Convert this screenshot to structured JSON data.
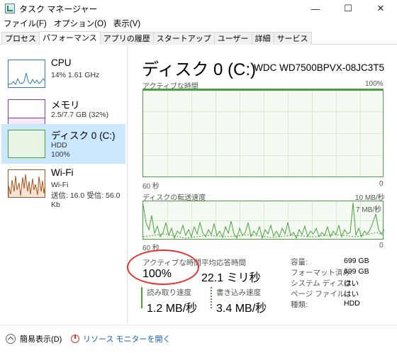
{
  "window": {
    "title": "タスク マネージャー",
    "min": "—",
    "max": "☐",
    "close": "✕"
  },
  "menu": [
    "ファイル(F)",
    "オプション(O)",
    "表示(V)"
  ],
  "tabs": [
    "プロセス",
    "パフォーマンス",
    "アプリの履歴",
    "スタートアップ",
    "ユーザー",
    "詳細",
    "サービス"
  ],
  "sidebar": [
    {
      "name": "CPU",
      "sub1": "14%  1.61 GHz",
      "sub2": "",
      "color": "#2f7bc1"
    },
    {
      "name": "メモリ",
      "sub1": "2.5/7.7 GB (32%)",
      "sub2": "",
      "color": "#8a3bb0"
    },
    {
      "name": "ディスク 0 (C:)",
      "sub1": "HDD",
      "sub2": "100%",
      "color": "#4aa03f"
    },
    {
      "name": "Wi-Fi",
      "sub1": "Wi-Fi",
      "sub2": "送信: 16.0  受信: 56.0 Kb",
      "color": "#a5551e"
    }
  ],
  "main": {
    "title": "ディスク 0 (C:)",
    "model": "WDC WD7500BPVX-08JC3T5",
    "chart1": {
      "label": "アクティブな時間",
      "max": "100%",
      "time_left": "60 秒",
      "time_right": "0"
    },
    "chart2": {
      "label": "ディスクの転送速度",
      "max": "10 MB/秒",
      "mark": "7 MB/秒",
      "time_left": "60 秒",
      "time_right": "0"
    }
  },
  "stats": {
    "active_time_label": "アクティブな時間",
    "active_time_value": "100%",
    "response_label": "平均応答時間",
    "response_value": "22.1 ミリ秒",
    "read_label": "読み取り速度",
    "read_value": "1.2 MB/秒",
    "write_label": "書き込み速度",
    "write_value": "3.4 MB/秒"
  },
  "info": [
    {
      "label": "容量:",
      "value": "699 GB"
    },
    {
      "label": "フォーマット済み:",
      "value": "699 GB"
    },
    {
      "label": "システム ディスク:",
      "value": "はい"
    },
    {
      "label": "ページ ファイル:",
      "value": "はい"
    },
    {
      "label": "種類:",
      "value": "HDD"
    }
  ],
  "footer": {
    "fewer": "簡易表示(D)",
    "monitor": "リソース モニターを開く"
  }
}
